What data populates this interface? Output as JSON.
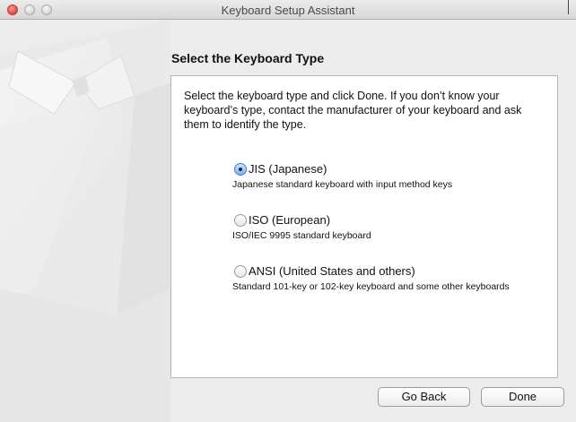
{
  "window": {
    "title": "Keyboard Setup Assistant"
  },
  "page": {
    "heading": "Select the Keyboard Type",
    "instructions": "Select the keyboard type and click Done. If you don’t know your keyboard’s type, contact the manufacturer of your keyboard and ask them to identify the type."
  },
  "options": [
    {
      "label": "JIS (Japanese)",
      "description": "Japanese standard keyboard with input method keys",
      "selected": true
    },
    {
      "label": "ISO (European)",
      "description": "ISO/IEC 9995 standard keyboard",
      "selected": false
    },
    {
      "label": "ANSI (United States and others)",
      "description": "Standard 101-key or 102-key keyboard and some other keyboards",
      "selected": false
    }
  ],
  "buttons": {
    "back": "Go Back",
    "done": "Done"
  },
  "colors": {
    "window_bg": "#ececec",
    "panel_bg": "#ffffff",
    "close_button": "#e0443e",
    "radio_selected": "#7fb2ee"
  }
}
